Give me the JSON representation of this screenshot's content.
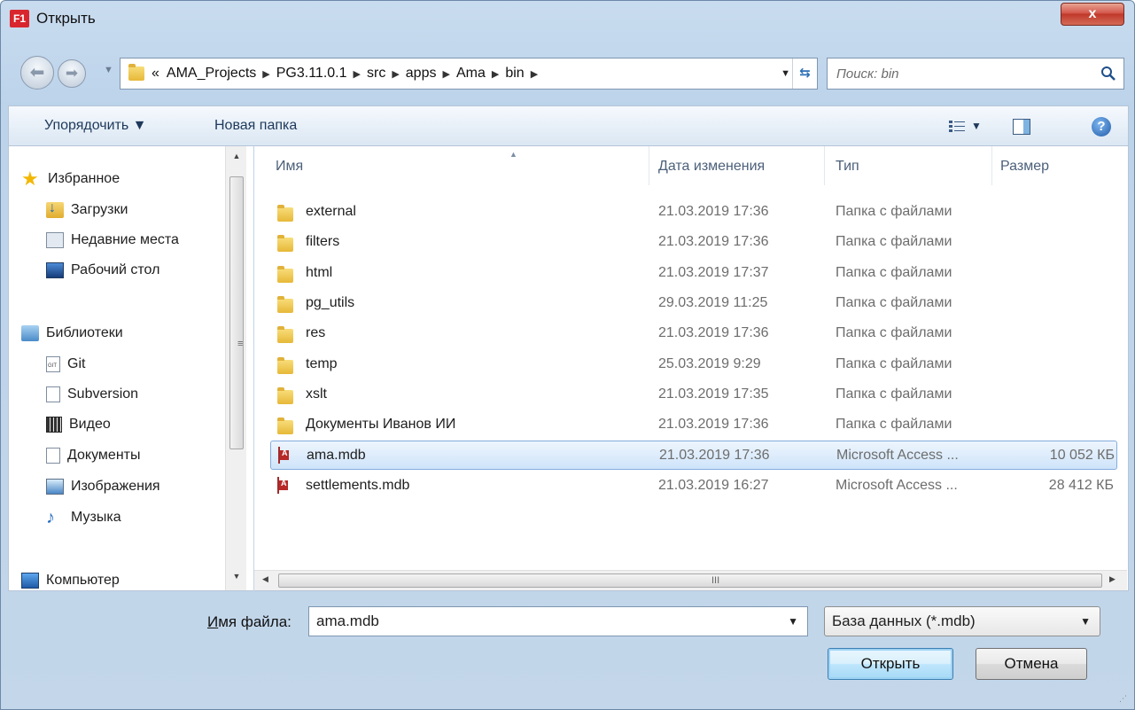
{
  "window": {
    "title": "Открыть",
    "app_icon": "F1",
    "close": "x"
  },
  "address": {
    "ellipsis": "«",
    "crumbs": [
      "AMA_Projects",
      "PG3.11.0.1",
      "src",
      "apps",
      "Ama",
      "bin"
    ]
  },
  "search": {
    "placeholder": "Поиск: bin"
  },
  "toolbar": {
    "organize": "Упорядочить ▼",
    "new_folder": "Новая папка",
    "help": "?"
  },
  "navpane": {
    "favorites": "Избранное",
    "downloads": "Загрузки",
    "recent": "Недавние места",
    "desktop": "Рабочий стол",
    "libraries": "Библиотеки",
    "git": "Git",
    "subversion": "Subversion",
    "video": "Видео",
    "documents": "Документы",
    "pictures": "Изображения",
    "music": "Музыка",
    "computer": "Компьютер"
  },
  "columns": {
    "name": "Имя",
    "date": "Дата изменения",
    "type": "Тип",
    "size": "Размер"
  },
  "files": [
    {
      "name": "external",
      "date": "21.03.2019 17:36",
      "type": "Папка с файлами",
      "size": ""
    },
    {
      "name": "filters",
      "date": "21.03.2019 17:36",
      "type": "Папка с файлами",
      "size": ""
    },
    {
      "name": "html",
      "date": "21.03.2019 17:37",
      "type": "Папка с файлами",
      "size": ""
    },
    {
      "name": "pg_utils",
      "date": "29.03.2019 11:25",
      "type": "Папка с файлами",
      "size": ""
    },
    {
      "name": "res",
      "date": "21.03.2019 17:36",
      "type": "Папка с файлами",
      "size": ""
    },
    {
      "name": "temp",
      "date": "25.03.2019 9:29",
      "type": "Папка с файлами",
      "size": ""
    },
    {
      "name": "xslt",
      "date": "21.03.2019 17:35",
      "type": "Папка с файлами",
      "size": ""
    },
    {
      "name": "Документы Иванов ИИ",
      "date": "21.03.2019 17:36",
      "type": "Папка с файлами",
      "size": ""
    },
    {
      "name": "ama.mdb",
      "date": "21.03.2019 17:36",
      "type": "Microsoft Access ...",
      "size": "10 052 КБ"
    },
    {
      "name": "settlements.mdb",
      "date": "21.03.2019 16:27",
      "type": "Microsoft Access ...",
      "size": "28 412 КБ"
    }
  ],
  "bottom": {
    "filename_label_u": "И",
    "filename_label_rest": "мя файла:",
    "filename_value": "ama.mdb",
    "filetype_value": "База данных (*.mdb)",
    "open_button": "Открыть",
    "cancel_button": "Отмена"
  },
  "colors": {
    "accent": "#3c7fb1",
    "selection": "#cfe4fa",
    "close_red": "#c0392b"
  }
}
